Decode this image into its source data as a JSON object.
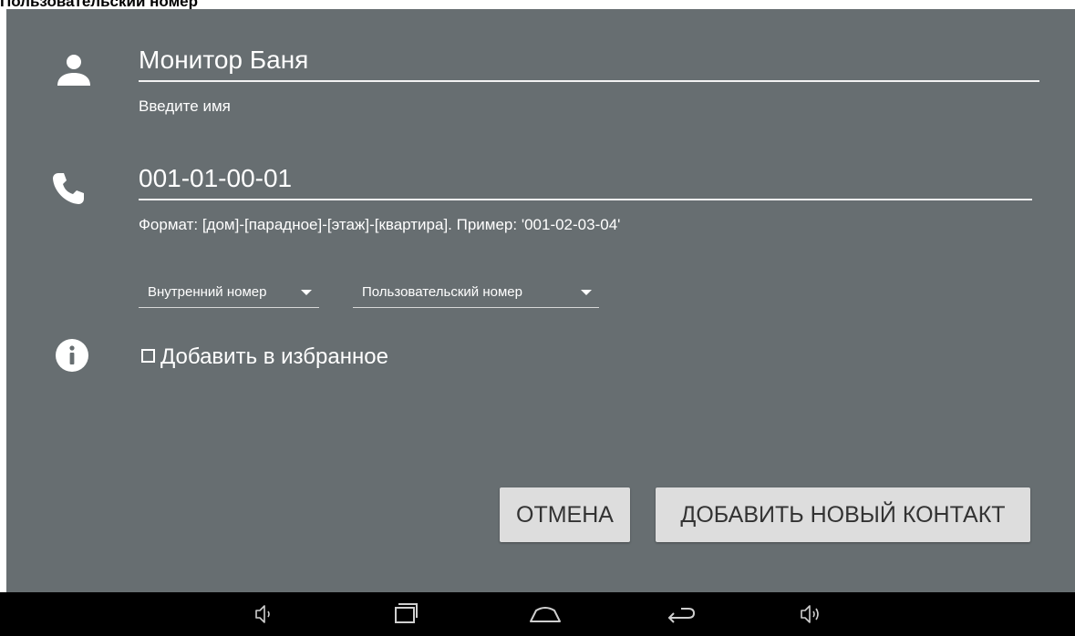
{
  "header": {
    "title": "Пользовательский номер"
  },
  "form": {
    "name_field": {
      "value": "Монитор Баня",
      "hint": "Введите имя",
      "icon": "person-icon"
    },
    "number_field": {
      "value": "001-01-00-01",
      "hint": "Формат: [дом]-[парадное]-[этаж]-[квартира]. Пример: '001-02-03-04'",
      "icon": "phone-icon"
    },
    "type_spinner": {
      "selected": "Внутренний номер"
    },
    "category_spinner": {
      "selected": "Пользовательский номер"
    },
    "favorite": {
      "label": "Добавить в избранное",
      "checked": false,
      "icon": "info-icon"
    }
  },
  "buttons": {
    "cancel": "ОТМЕНА",
    "add_contact": "ДОБАВИТЬ НОВЫЙ КОНТАКТ"
  },
  "navbar": {
    "items": [
      "volume-down-icon",
      "recent-apps-icon",
      "home-icon",
      "back-icon",
      "volume-up-icon"
    ]
  },
  "colors": {
    "panel_bg": "#676e71",
    "navbar_bg": "#000000",
    "button_bg": "#dddddd",
    "button_text": "#333333"
  }
}
